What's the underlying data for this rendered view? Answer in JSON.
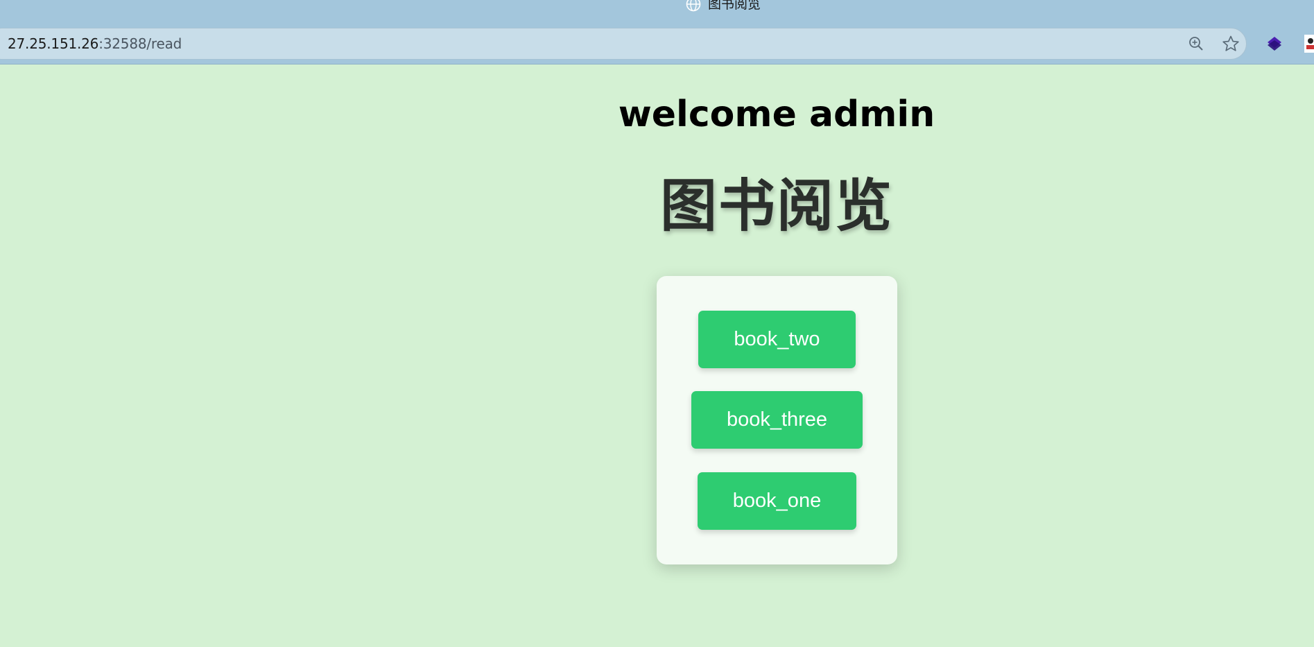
{
  "browser": {
    "tab_title": "图书阅览",
    "url_host": "27.25.151.26",
    "url_rest": ":32588/read",
    "icons": {
      "tab": "globe-icon",
      "zoom": "zoom-in-icon",
      "bookmark": "star-icon",
      "extension": "extension-icon",
      "profile": "avatar-icon"
    }
  },
  "page": {
    "welcome": "welcome admin",
    "title": "图书阅览"
  },
  "books": [
    {
      "label": "book_two"
    },
    {
      "label": "book_three"
    },
    {
      "label": "book_one"
    }
  ],
  "colors": {
    "page_background": "#d4f1d3",
    "button": "#2ecc71",
    "card": "#f4fbf4",
    "chrome": "#a3c6dc"
  }
}
